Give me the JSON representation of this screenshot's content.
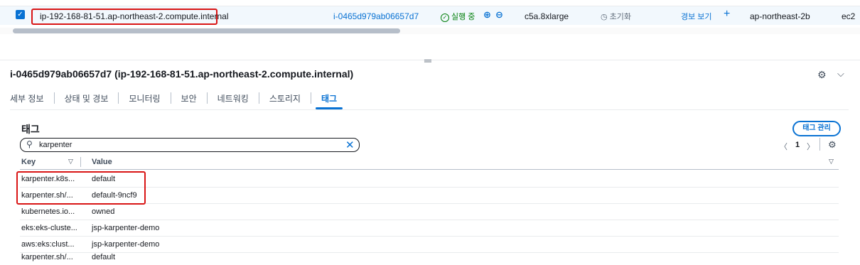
{
  "instance_row": {
    "hostname": "ip-192-168-81-51.ap-northeast-2.compute.internal",
    "instance_id": "i-0465d979ab06657d7",
    "state": "실행 중",
    "instance_type": "c5a.8xlarge",
    "status_check": "초기화",
    "alarm_link": "경보 보기",
    "availability_zone": "ap-northeast-2b",
    "truncated_next_col": "ec2"
  },
  "detail": {
    "title": "i-0465d979ab06657d7 (ip-192-168-81-51.ap-northeast-2.compute.internal)",
    "tabs": [
      {
        "label": "세부 정보"
      },
      {
        "label": "상태 및 경보"
      },
      {
        "label": "모니터링"
      },
      {
        "label": "보안"
      },
      {
        "label": "네트워킹"
      },
      {
        "label": "스토리지"
      },
      {
        "label": "태그"
      }
    ],
    "active_tab": "태그"
  },
  "tags_panel": {
    "title": "태그",
    "manage_button": "태그 관리",
    "search": {
      "value": "karpenter"
    },
    "pagination": {
      "page": "1"
    },
    "columns": {
      "key": "Key",
      "value": "Value"
    },
    "rows": [
      {
        "key": "karpenter.k8s...",
        "value": "default"
      },
      {
        "key": "karpenter.sh/...",
        "value": "default-9ncf9"
      },
      {
        "key": "kubernetes.io...",
        "value": "owned"
      },
      {
        "key": "eks:eks-cluste...",
        "value": "jsp-karpenter-demo"
      },
      {
        "key": "aws:eks:clust...",
        "value": "jsp-karpenter-demo"
      },
      {
        "key": "karpenter.sh/...",
        "value": "default"
      }
    ]
  },
  "colors": {
    "accent": "#0972d3",
    "success": "#037f0c",
    "highlight": "#d91515"
  }
}
